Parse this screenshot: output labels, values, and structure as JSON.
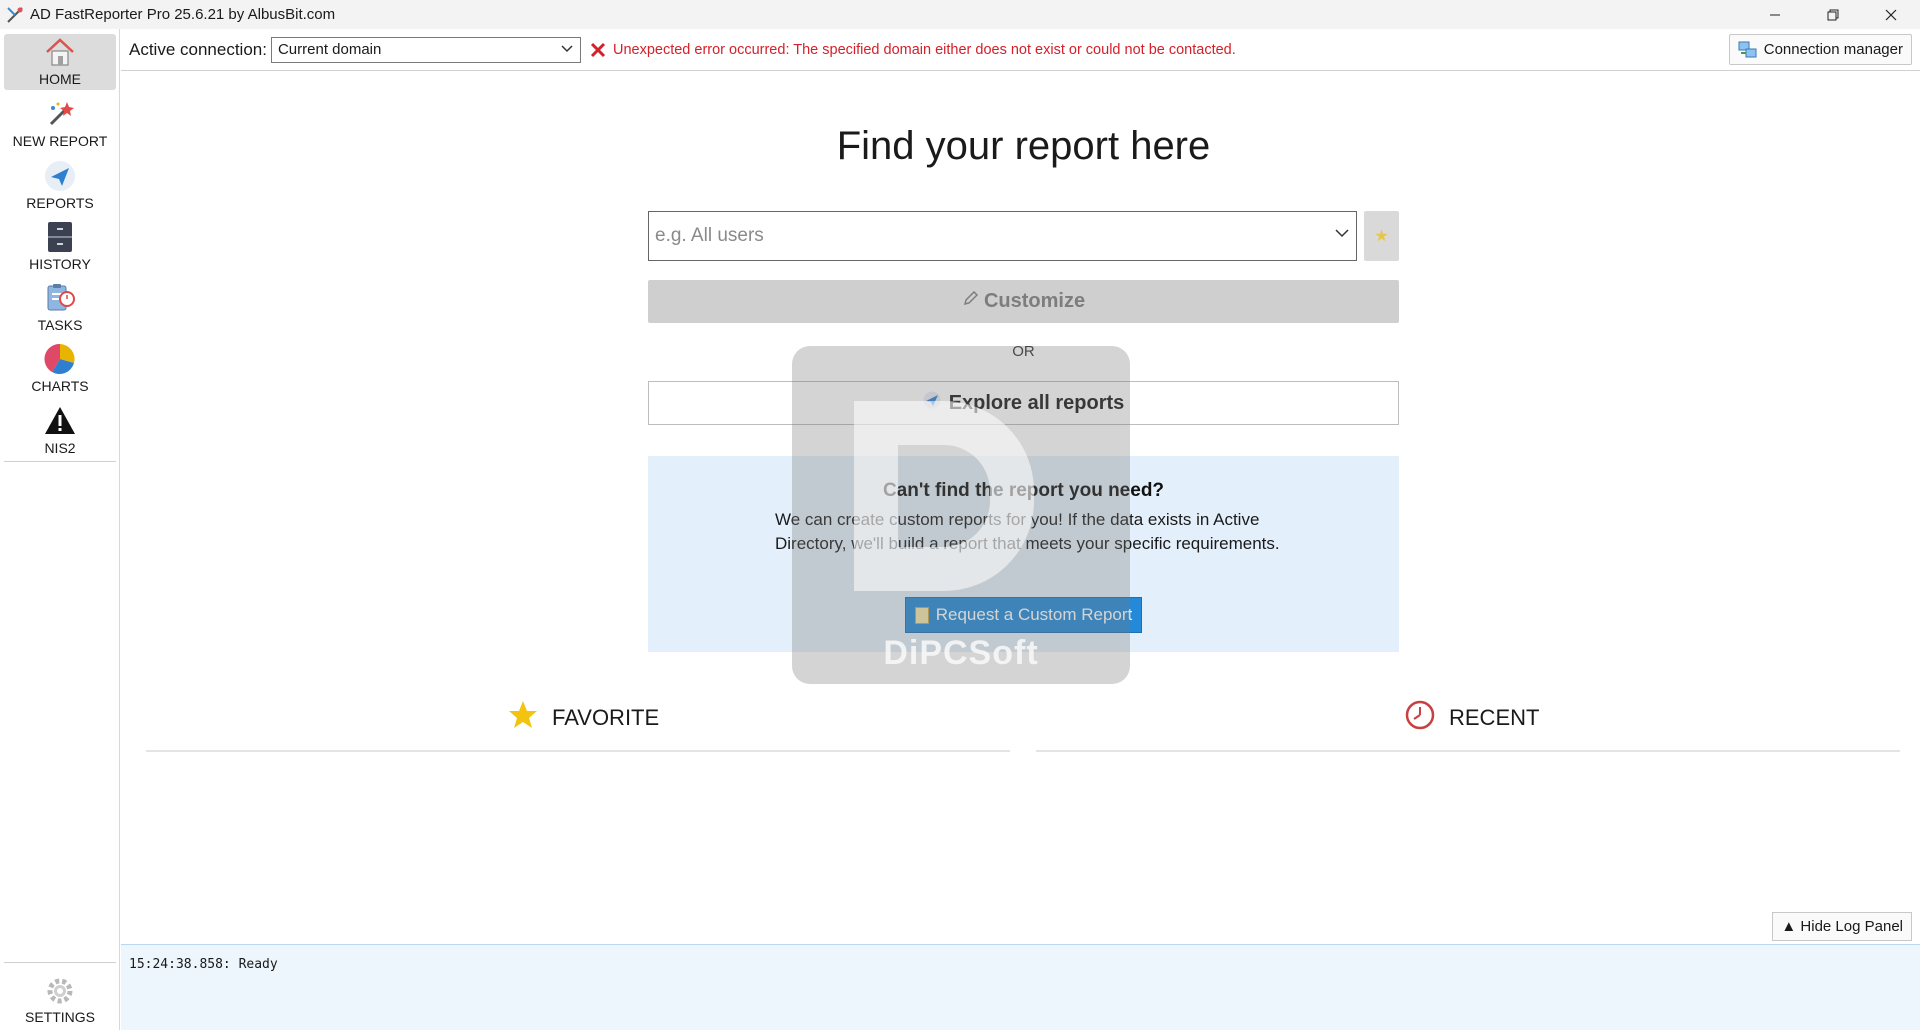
{
  "window": {
    "title": "AD FastReporter Pro 25.6.21 by AlbusBit.com",
    "controls": [
      "minimize-icon",
      "restore-icon",
      "close-icon"
    ]
  },
  "sidebar": {
    "items": [
      {
        "label": "HOME",
        "icon": "home-icon",
        "active": true
      },
      {
        "label": "NEW REPORT",
        "icon": "magic-wand-icon"
      },
      {
        "label": "REPORTS",
        "icon": "paper-plane-icon"
      },
      {
        "label": "HISTORY",
        "icon": "file-cabinet-icon"
      },
      {
        "label": "TASKS",
        "icon": "clipboard-clock-icon"
      },
      {
        "label": "CHARTS",
        "icon": "pie-chart-icon"
      },
      {
        "label": "NIS2",
        "icon": "warning-icon"
      }
    ],
    "settings_label": "SETTINGS"
  },
  "connection": {
    "label": "Active connection:",
    "selected": "Current domain",
    "error": "Unexpected error occurred: The specified domain either does not exist or could not be contacted.",
    "manager_label": "Connection manager"
  },
  "main": {
    "heading": "Find your report here",
    "search_placeholder": "e.g. All users",
    "customize_label": "Customize",
    "or_label": "OR",
    "explore_label": "Explore all reports",
    "custom_panel": {
      "title": "Can't find the report you need?",
      "body": "We can create custom reports for you! If the data exists in Active Directory, we'll build a report that meets your specific requirements.",
      "button": "Request a Custom Report"
    },
    "favorite_label": "FAVORITE",
    "recent_label": "RECENT",
    "hide_log_label": "▲ Hide Log Panel"
  },
  "watermark": "DiPCSoft",
  "log": {
    "lines": [
      "15:24:38.858: Ready"
    ]
  },
  "colors": {
    "error": "#d4202a",
    "accent_button": "#2389d8",
    "panel_bg": "#e3f0fb",
    "log_bg": "#edf6fd"
  }
}
